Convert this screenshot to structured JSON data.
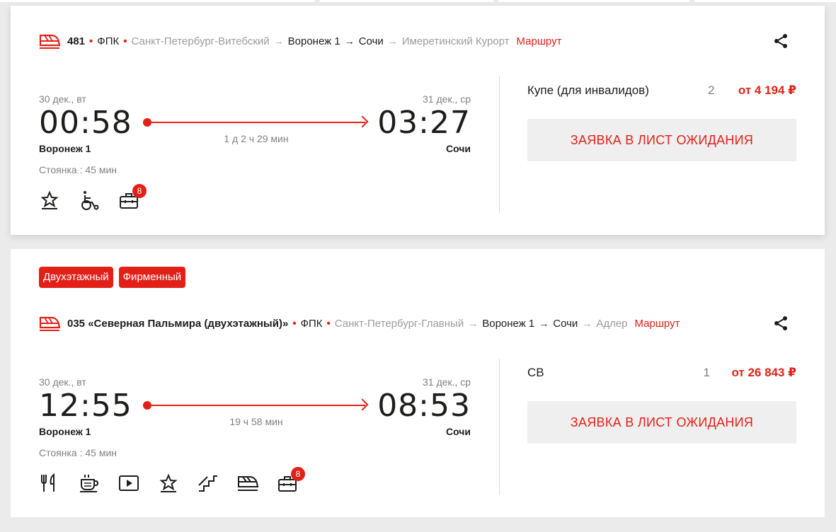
{
  "colors": {
    "accent": "#e32017",
    "text": "#1d1d1b",
    "muted": "#9a9ca1",
    "button_bg": "#efefef"
  },
  "trains": [
    {
      "tags": [],
      "number": "481",
      "carrier": "ФПК",
      "route_from": "Санкт-Петербург-Витебский",
      "seg_from": "Воронеж 1",
      "seg_to": "Сочи",
      "route_to": "Имеретинский Курорт",
      "route_link": "Маршрут",
      "dep_date": "30 дек., вт",
      "arr_date": "31 дек., ср",
      "dep_time": "00:58",
      "arr_time": "03:27",
      "duration": "1 д 2 ч 29 мин",
      "dep_station": "Воронеж 1",
      "arr_station": "Сочи",
      "stop": "Стоянка : 45 мин",
      "amenities": [
        "star-icon",
        "wheelchair-icon",
        "luggage-icon"
      ],
      "luggage_badge": "8",
      "fare": {
        "class": "Купе (для инвалидов)",
        "seats": "2",
        "price": "от 4 194 ₽"
      },
      "wait_button": "ЗАЯВКА В ЛИСТ ОЖИДАНИЯ"
    },
    {
      "tags": [
        "Двухэтажный",
        "Фирменный"
      ],
      "number": "035 «Северная Пальмира (двухэтажный)»",
      "carrier": "ФПК",
      "route_from": "Санкт-Петербург-Главный",
      "seg_from": "Воронеж 1",
      "seg_to": "Сочи",
      "route_to": "Адлер",
      "route_link": "Маршрут",
      "dep_date": "30 дек., вт",
      "arr_date": "31 дек., ср",
      "dep_time": "12:55",
      "arr_time": "08:53",
      "duration": "19 ч 58 мин",
      "dep_station": "Воронеж 1",
      "arr_station": "Сочи",
      "stop": "Стоянка : 45 мин",
      "amenities": [
        "restaurant-icon",
        "coffee-icon",
        "video-icon",
        "star-icon",
        "stairs-icon",
        "train-icon",
        "luggage-icon"
      ],
      "luggage_badge": "8",
      "fare": {
        "class": "СВ",
        "seats": "1",
        "price": "от 26 843 ₽"
      },
      "wait_button": "ЗАЯВКА В ЛИСТ ОЖИДАНИЯ"
    }
  ]
}
